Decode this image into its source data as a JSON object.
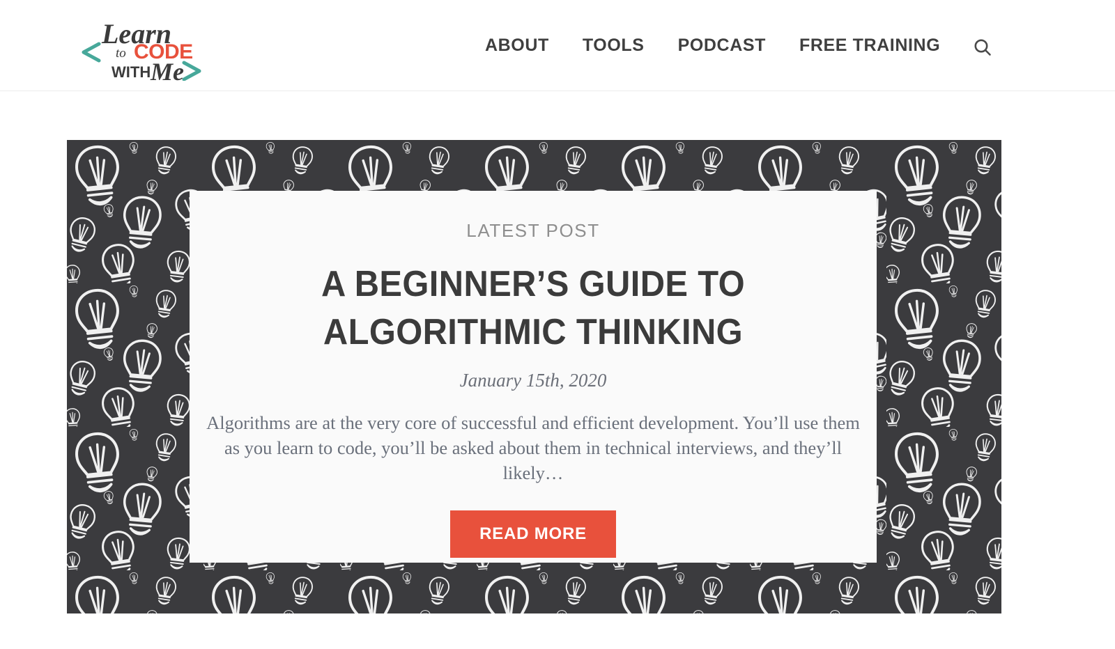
{
  "header": {
    "logo": {
      "name": "learn-to-code-with-me-logo",
      "alt_text": "Learn to Code With Me",
      "word_learn": "Learn",
      "word_to": "to",
      "word_code": "CODE",
      "word_with": "WITH",
      "word_me": "Me",
      "bracket_left": "<",
      "bracket_right": ">",
      "bracket_color": "#47a89a",
      "code_color": "#e8513c",
      "script_color": "#3b3b3b"
    },
    "nav": [
      {
        "label": "ABOUT",
        "name": "nav-link-about"
      },
      {
        "label": "TOOLS",
        "name": "nav-link-tools"
      },
      {
        "label": "PODCAST",
        "name": "nav-link-podcast"
      },
      {
        "label": "FREE TRAINING",
        "name": "nav-link-free-training"
      }
    ],
    "search": {
      "icon": "search-icon",
      "label": "Search"
    }
  },
  "hero": {
    "background": {
      "name": "lightbulb-pattern",
      "color": "#3b3b3e",
      "line_color": "#f2f2f2"
    },
    "card": {
      "kicker": "LATEST POST",
      "title": "A BEGINNER’S GUIDE TO ALGORITHMIC THINKING",
      "date": "January 15th, 2020",
      "excerpt": "Algorithms are at the very core of successful and efficient development. You’ll use them as you learn to code, you’ll be asked about them in technical interviews, and they’ll likely…",
      "cta_label": "READ MORE",
      "cta_color": "#e8513c",
      "background_color": "#fafafa"
    }
  }
}
